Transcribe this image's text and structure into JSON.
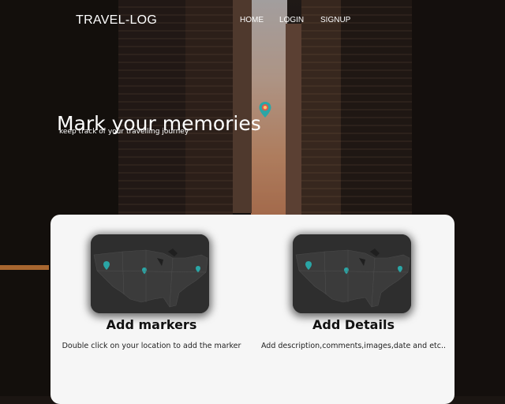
{
  "nav": {
    "brand": "TRAVEL-LOG",
    "links": [
      "HOME",
      "LOGIN",
      "SIGNUP"
    ]
  },
  "hero": {
    "headline": "Mark your memories",
    "tagline": "keep track of your travelling journey",
    "pin_icon": "location-pin-icon"
  },
  "features": [
    {
      "title": "Add markers",
      "description": "Double click on your location to add the marker",
      "image": "usa-map-thumbnail"
    },
    {
      "title": "Add Details",
      "description": "Add description,comments,images,date and etc..",
      "image": "usa-map-thumbnail"
    }
  ],
  "colors": {
    "card_bg": "#f6f6f6",
    "text_light": "#ffffff",
    "map_bg": "#2b2b2b",
    "pin_teal": "#2aa6a6",
    "pin_red": "#e0574b"
  }
}
